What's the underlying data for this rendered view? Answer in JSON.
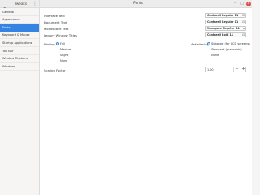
{
  "app": {
    "title": "Tweaks",
    "window_title": "Fonts"
  },
  "sidebar": {
    "items": [
      {
        "label": "General"
      },
      {
        "label": "Appearance"
      },
      {
        "label": "Fonts"
      },
      {
        "label": "Keyboard & Mouse"
      },
      {
        "label": "Startup Applications"
      },
      {
        "label": "Top Bar"
      },
      {
        "label": "Window Titlebars"
      },
      {
        "label": "Windows"
      }
    ],
    "active_index": 2
  },
  "fonts": {
    "interface_label": "Interface Text",
    "interface_value": "Cantarell Regular 11",
    "document_label": "Document Text",
    "document_value": "Cantarell Regular 11",
    "monospace_label": "Monospace Text",
    "monospace_value": "Monospace Regular 11",
    "legacy_label": "Legacy Window Titles",
    "legacy_value": "Cantarell Bold 11"
  },
  "hinting": {
    "label": "Hinting",
    "options": [
      "Full",
      "Medium",
      "Slight",
      "None"
    ],
    "selected": "Full"
  },
  "antialiasing": {
    "label": "Antialiasing",
    "options": [
      "Subpixel (for LCD screens)",
      "Standard (grayscale)",
      "None"
    ],
    "selected": "Subpixel (for LCD screens)"
  },
  "scaling": {
    "label": "Scaling Factor",
    "value": "1.00",
    "minus": "−",
    "plus": "+"
  },
  "icons": {
    "search": "search-icon",
    "menu": "menu-icon",
    "font_picker": "font-picker-icon"
  },
  "colors": {
    "accent": "#3584e4",
    "close": "#e14f4f"
  }
}
